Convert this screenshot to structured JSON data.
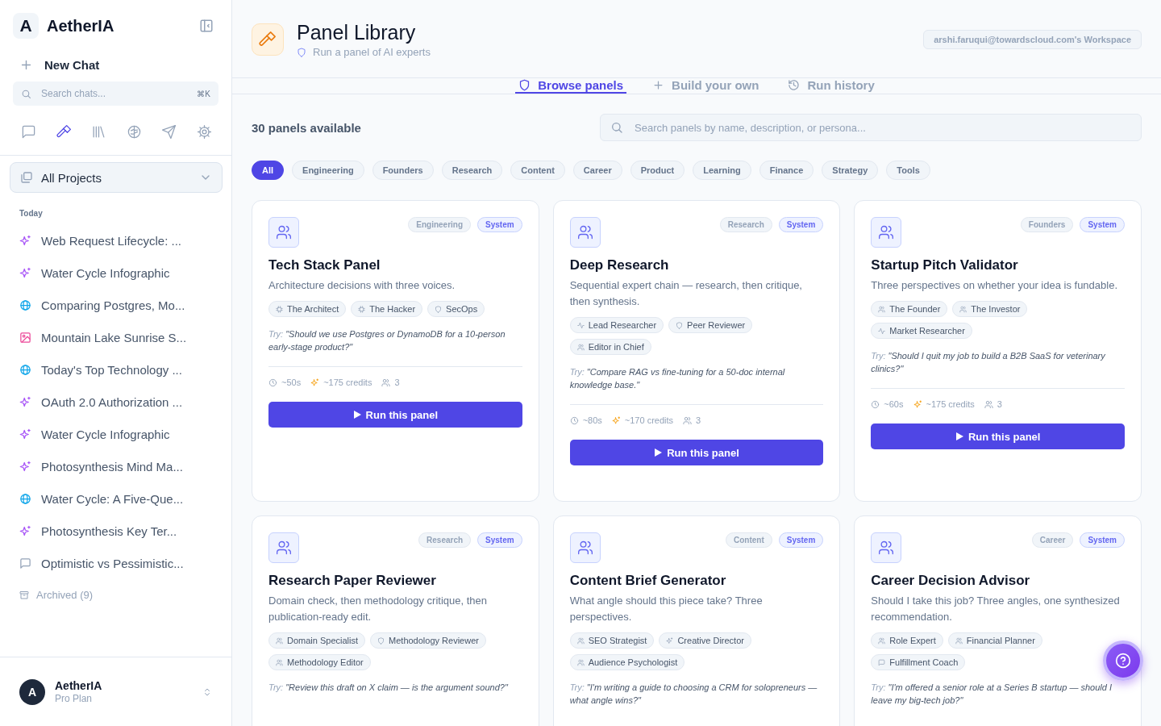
{
  "app": {
    "logo_letter": "A",
    "name": "AetherIA"
  },
  "new_chat": "New Chat",
  "chat_search": {
    "placeholder": "Search chats...",
    "shortcut": "⌘K"
  },
  "nav_icons": [
    {
      "kind": "chat",
      "selected": false
    },
    {
      "kind": "hammer",
      "selected": true
    },
    {
      "kind": "library",
      "selected": false
    },
    {
      "kind": "brain",
      "selected": false
    },
    {
      "kind": "send",
      "selected": false
    },
    {
      "kind": "gear",
      "selected": false
    }
  ],
  "project_selector": "All Projects",
  "section_label": "Today",
  "chats": [
    {
      "title": "Web Request Lifecycle: ...",
      "kind": "sparkle"
    },
    {
      "title": "Water Cycle Infographic",
      "kind": "sparkle"
    },
    {
      "title": "Comparing Postgres, Mo...",
      "kind": "globe"
    },
    {
      "title": "Mountain Lake Sunrise S...",
      "kind": "image"
    },
    {
      "title": "Today's Top Technology ...",
      "kind": "globe"
    },
    {
      "title": "OAuth 2.0 Authorization ...",
      "kind": "sparkle"
    },
    {
      "title": "Water Cycle Infographic",
      "kind": "sparkle"
    },
    {
      "title": "Photosynthesis Mind Ma...",
      "kind": "sparkle"
    },
    {
      "title": "Water Cycle: A Five-Que...",
      "kind": "globe"
    },
    {
      "title": "Photosynthesis Key Ter...",
      "kind": "sparkle"
    },
    {
      "title": "Optimistic vs Pessimistic...",
      "kind": "chat"
    }
  ],
  "archived": "Archived (9)",
  "user": {
    "avatar": "A",
    "name": "AetherIA",
    "plan": "Pro Plan"
  },
  "header": {
    "title": "Panel Library",
    "subtitle": "Run a panel of AI experts",
    "workspace": "arshi.faruqui@towardscloud.com's Workspace"
  },
  "tabs": [
    {
      "label": "Browse panels",
      "kind": "shield",
      "selected": true
    },
    {
      "label": "Build your own",
      "kind": "plus",
      "selected": false
    },
    {
      "label": "Run history",
      "kind": "history",
      "selected": false
    }
  ],
  "count": "30 panels available",
  "panel_search": {
    "placeholder": "Search panels by name, description, or persona..."
  },
  "filters": [
    {
      "label": "All",
      "selected": true
    },
    {
      "label": "Engineering",
      "selected": false
    },
    {
      "label": "Founders",
      "selected": false
    },
    {
      "label": "Research",
      "selected": false
    },
    {
      "label": "Content",
      "selected": false
    },
    {
      "label": "Career",
      "selected": false
    },
    {
      "label": "Product",
      "selected": false
    },
    {
      "label": "Learning",
      "selected": false
    },
    {
      "label": "Finance",
      "selected": false
    },
    {
      "label": "Strategy",
      "selected": false
    },
    {
      "label": "Tools",
      "selected": false
    }
  ],
  "panels": [
    {
      "category": "Engineering",
      "badge": "System",
      "title": "Tech Stack Panel",
      "description": "Architecture decisions with three voices.",
      "personas": [
        {
          "name": "The Architect",
          "kind": "cpu"
        },
        {
          "name": "The Hacker",
          "kind": "cpu"
        },
        {
          "name": "SecOps",
          "kind": "shield"
        }
      ],
      "try_label": "Try:",
      "try_text": "\"Should we use Postgres or DynamoDB for a 10-person early-stage product?\"",
      "time": "~50s",
      "credits": "~175 credits",
      "members": "3",
      "button": "Run this panel"
    },
    {
      "category": "Research",
      "badge": "System",
      "title": "Deep Research",
      "description": "Sequential expert chain — research, then critique, then synthesis.",
      "personas": [
        {
          "name": "Lead Researcher",
          "kind": "activity"
        },
        {
          "name": "Peer Reviewer",
          "kind": "shield"
        },
        {
          "name": "Editor in Chief",
          "kind": "users"
        }
      ],
      "try_label": "Try:",
      "try_text": "\"Compare RAG vs fine-tuning for a 50-doc internal knowledge base.\"",
      "time": "~80s",
      "credits": "~170 credits",
      "members": "3",
      "button": "Run this panel"
    },
    {
      "category": "Founders",
      "badge": "System",
      "title": "Startup Pitch Validator",
      "description": "Three perspectives on whether your idea is fundable.",
      "personas": [
        {
          "name": "The Founder",
          "kind": "users"
        },
        {
          "name": "The Investor",
          "kind": "users"
        },
        {
          "name": "Market Researcher",
          "kind": "activity"
        }
      ],
      "try_label": "Try:",
      "try_text": "\"Should I quit my job to build a B2B SaaS for veterinary clinics?\"",
      "time": "~60s",
      "credits": "~175 credits",
      "members": "3",
      "button": "Run this panel"
    },
    {
      "category": "Research",
      "badge": "System",
      "title": "Research Paper Reviewer",
      "description": "Domain check, then methodology critique, then publication-ready edit.",
      "personas": [
        {
          "name": "Domain Specialist",
          "kind": "users"
        },
        {
          "name": "Methodology Reviewer",
          "kind": "shield"
        },
        {
          "name": "Methodology Editor",
          "kind": "users"
        }
      ],
      "try_label": "Try:",
      "try_text": "\"Review this draft on X claim — is the argument sound?\""
    },
    {
      "category": "Content",
      "badge": "System",
      "title": "Content Brief Generator",
      "description": "What angle should this piece take? Three perspectives.",
      "personas": [
        {
          "name": "SEO Strategist",
          "kind": "users"
        },
        {
          "name": "Creative Director",
          "kind": "sparkle"
        },
        {
          "name": "Audience Psychologist",
          "kind": "users"
        }
      ],
      "try_label": "Try:",
      "try_text": "\"I'm writing a guide to choosing a CRM for solopreneurs — what angle wins?\""
    },
    {
      "category": "Career",
      "badge": "System",
      "title": "Career Decision Advisor",
      "description": "Should I take this job? Three angles, one synthesized recommendation.",
      "personas": [
        {
          "name": "Role Expert",
          "kind": "users"
        },
        {
          "name": "Financial Planner",
          "kind": "users"
        },
        {
          "name": "Fulfillment Coach",
          "kind": "chat"
        }
      ],
      "try_label": "Try:",
      "try_text": "\"I'm offered a senior role at a Series B startup — should I leave my big-tech job?\""
    }
  ]
}
